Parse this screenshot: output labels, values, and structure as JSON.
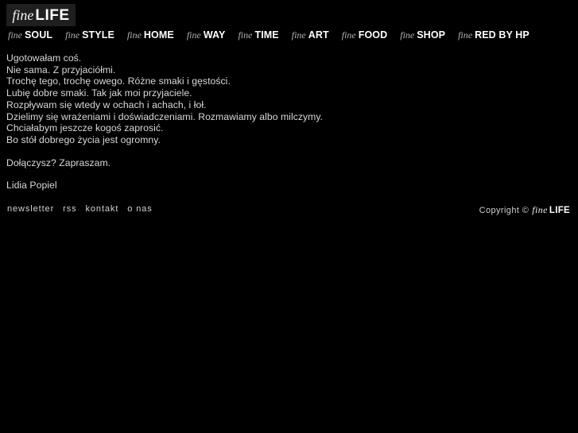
{
  "site": {
    "background_color": "#000000",
    "text_color": "#d9d9d9",
    "logo_box_color": "#1f1f1f"
  },
  "logo": {
    "prefix": "fine",
    "name": "LIFE"
  },
  "nav": {
    "prefix": "fine",
    "items": [
      {
        "prefix": "fine",
        "label": "SOUL"
      },
      {
        "prefix": "fine",
        "label": "STYLE"
      },
      {
        "prefix": "fine",
        "label": "HOME"
      },
      {
        "prefix": "fine",
        "label": "WAY"
      },
      {
        "prefix": "fine",
        "label": "TIME"
      },
      {
        "prefix": "fine",
        "label": "ART"
      },
      {
        "prefix": "fine",
        "label": "FOOD"
      },
      {
        "prefix": "fine",
        "label": "SHOP"
      },
      {
        "prefix": "fine",
        "label": "RED BY HP"
      }
    ]
  },
  "article": {
    "paragraphs": [
      {
        "lines": [
          "Ugotowałam coś.",
          "Nie sama. Z przyjaciółmi.",
          "Trochę tego, trochę owego. Różne smaki i gęstości.",
          "Lubię dobre smaki. Tak jak moi przyjaciele.",
          "Rozpływam się wtedy w ochach i achach, i łoł.",
          "Dzielimy się wrażeniami i doświadczeniami. Rozmawiamy albo milczymy.",
          "Chciałabym jeszcze kogoś zaprosić.",
          "Bo stół dobrego życia jest ogromny."
        ]
      },
      {
        "lines": [
          "Dołączysz? Zapraszam."
        ]
      },
      {
        "lines": [
          "Lidia Popiel"
        ]
      }
    ]
  },
  "footer": {
    "links": [
      {
        "label": "newsletter"
      },
      {
        "label": "rss"
      },
      {
        "label": "kontakt"
      },
      {
        "label": "o nas"
      }
    ],
    "copyright": {
      "text": "Copyright ©",
      "brand_prefix": "fine",
      "brand_name": "LIFE"
    }
  }
}
